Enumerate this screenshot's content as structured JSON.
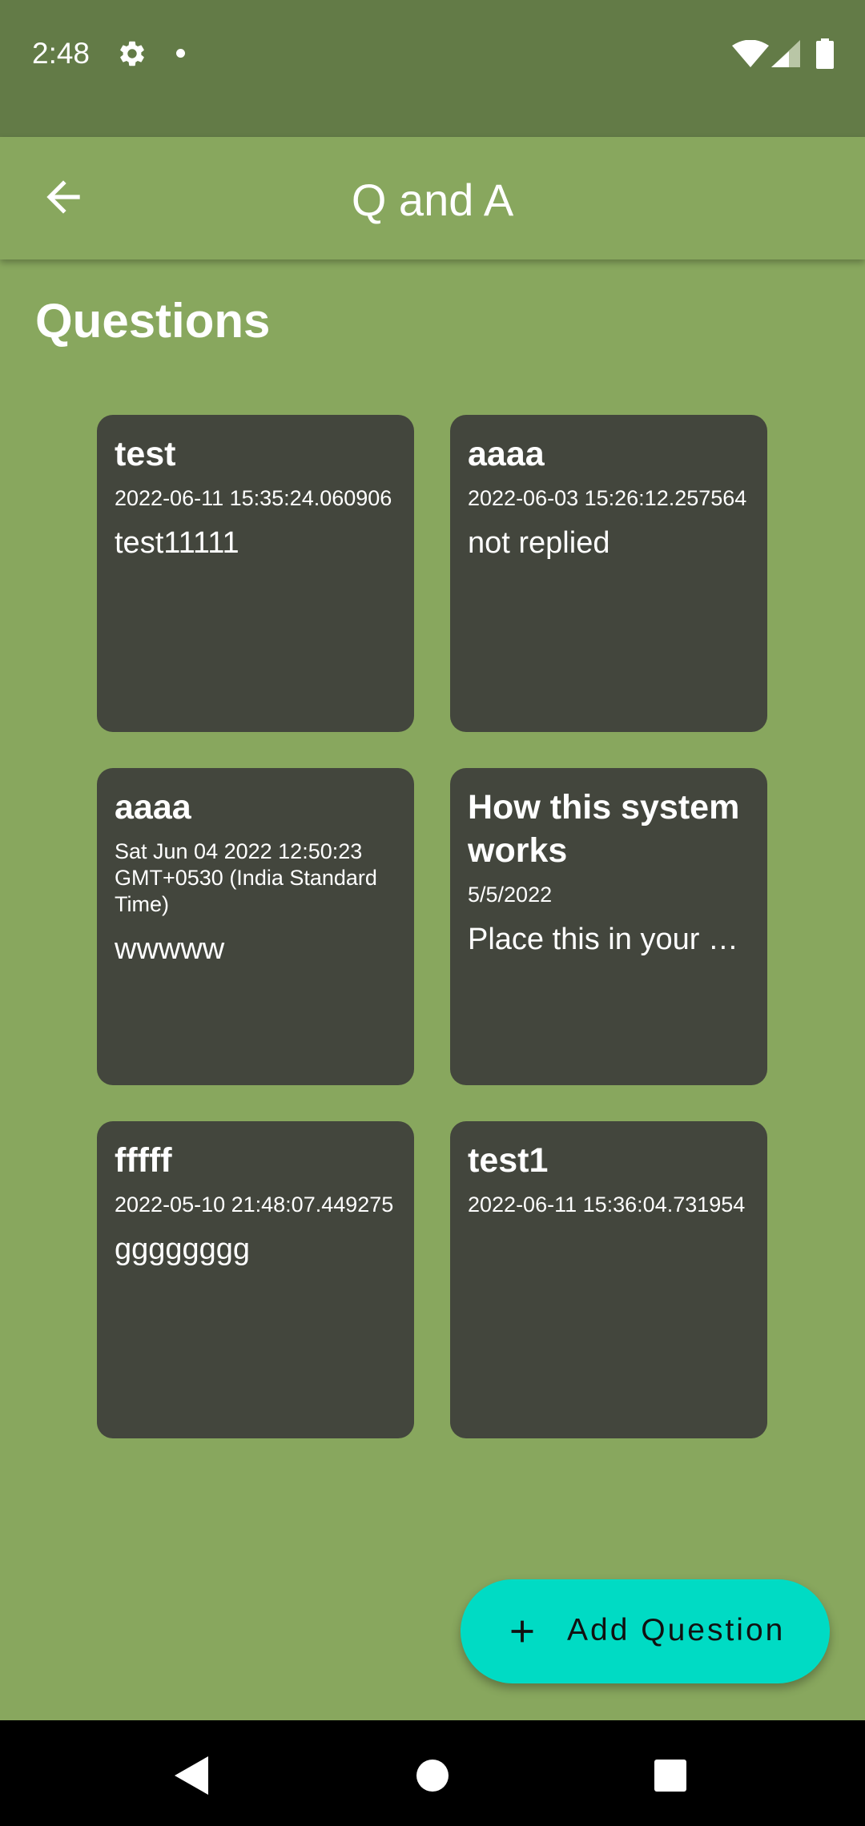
{
  "status_bar": {
    "time": "2:48",
    "icons": [
      "gear-icon",
      "dot-icon",
      "wifi-icon",
      "signal-icon",
      "battery-icon"
    ]
  },
  "app_bar": {
    "title": "Q and A",
    "back_icon": "arrow-left-icon"
  },
  "section_title": "Questions",
  "questions": [
    {
      "title": "test",
      "date": "2022-06-11 15:35:24.060906",
      "body": "test11111"
    },
    {
      "title": "aaaa",
      "date": "2022-06-03 15:26:12.257564",
      "body": "not replied"
    },
    {
      "title": "aaaa",
      "date": "Sat Jun 04 2022 12:50:23 GMT+0530 (India Standard Time)",
      "body": "wwwww"
    },
    {
      "title": "How this system works",
      "date": "5/5/2022",
      "body": "Place this in your …"
    },
    {
      "title": "fffff",
      "date": "2022-05-10 21:48:07.449275",
      "body": "gggggggg"
    },
    {
      "title": "test1",
      "date": "2022-06-11 15:36:04.731954",
      "body": ""
    }
  ],
  "fab": {
    "label": "Add Question",
    "icon": "plus-icon"
  },
  "colors": {
    "status_bar": "#637b47",
    "background": "#88a75e",
    "card": "#43463d",
    "fab": "#00dbc4"
  },
  "nav_bar": {
    "icons": [
      "nav-back-icon",
      "nav-home-icon",
      "nav-recents-icon"
    ]
  }
}
